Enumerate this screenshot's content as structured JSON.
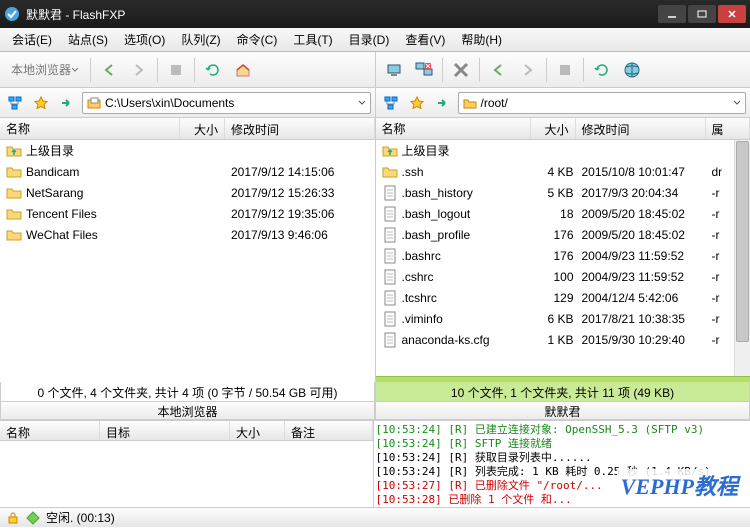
{
  "title": "默默君 - FlashFXP",
  "menus": [
    "会话(E)",
    "站点(S)",
    "选项(O)",
    "队列(Z)",
    "命令(C)",
    "工具(T)",
    "目录(D)",
    "查看(V)",
    "帮助(H)"
  ],
  "left": {
    "browser_label": "本地浏览器",
    "path": "C:\\Users\\xin\\Documents",
    "cols": {
      "name": "名称",
      "size": "大小",
      "date": "修改时间"
    },
    "up": "上级目录",
    "rows": [
      {
        "name": "Bandicam",
        "size": "",
        "date": "2017/9/12 14:15:06",
        "type": "folder"
      },
      {
        "name": "NetSarang",
        "size": "",
        "date": "2017/9/12 15:26:33",
        "type": "folder"
      },
      {
        "name": "Tencent Files",
        "size": "",
        "date": "2017/9/12 19:35:06",
        "type": "folder"
      },
      {
        "name": "WeChat Files",
        "size": "",
        "date": "2017/9/13 9:46:06",
        "type": "folder"
      }
    ],
    "status": "0 个文件, 4 个文件夹, 共计 4 项 (0 字节 / 50.54 GB 可用)",
    "sub": "本地浏览器"
  },
  "right": {
    "path": "/root/",
    "cols": {
      "name": "名称",
      "size": "大小",
      "date": "修改时间",
      "attr": "属"
    },
    "up": "上级目录",
    "rows": [
      {
        "name": ".ssh",
        "size": "4 KB",
        "date": "2015/10/8 10:01:47",
        "attr": "dr",
        "type": "folder"
      },
      {
        "name": ".bash_history",
        "size": "5 KB",
        "date": "2017/9/3 20:04:34",
        "attr": "-r",
        "type": "file"
      },
      {
        "name": ".bash_logout",
        "size": "18",
        "date": "2009/5/20 18:45:02",
        "attr": "-r",
        "type": "file"
      },
      {
        "name": ".bash_profile",
        "size": "176",
        "date": "2009/5/20 18:45:02",
        "attr": "-r",
        "type": "file"
      },
      {
        "name": ".bashrc",
        "size": "176",
        "date": "2004/9/23 11:59:52",
        "attr": "-r",
        "type": "file"
      },
      {
        "name": ".cshrc",
        "size": "100",
        "date": "2004/9/23 11:59:52",
        "attr": "-r",
        "type": "file"
      },
      {
        "name": ".tcshrc",
        "size": "129",
        "date": "2004/12/4 5:42:06",
        "attr": "-r",
        "type": "file"
      },
      {
        "name": ".viminfo",
        "size": "6 KB",
        "date": "2017/8/21 10:38:35",
        "attr": "-r",
        "type": "file"
      },
      {
        "name": "anaconda-ks.cfg",
        "size": "1 KB",
        "date": "2015/9/30 10:29:40",
        "attr": "-r",
        "type": "file"
      }
    ],
    "status": "10 个文件, 1 个文件夹, 共计 11 项 (49 KB)",
    "sub": "默默君"
  },
  "queue_cols": {
    "name": "名称",
    "target": "目标",
    "size": "大小",
    "remark": "备注"
  },
  "log": [
    {
      "cls": "log-green",
      "text": "[10:53:24] [R] 已建立连接对象: OpenSSH_5.3 (SFTP v3)"
    },
    {
      "cls": "log-green",
      "text": "[10:53:24] [R] SFTP 连接就绪"
    },
    {
      "cls": "log-black",
      "text": "[10:53:24] [R] 获取目录列表中......"
    },
    {
      "cls": "log-black",
      "text": "[10:53:24] [R] 列表完成: 1 KB  耗时 0.25 秒 (1.4 KB/s)"
    },
    {
      "cls": "log-red",
      "text": "[10:53:27] [R] 已删除文件 \"/root/..."
    },
    {
      "cls": "log-red",
      "text": "[10:53:28] 已删除 1 个文件 和..."
    }
  ],
  "footer": {
    "idle": "空闲. (00:13)"
  },
  "watermark": "VEPHP教程"
}
